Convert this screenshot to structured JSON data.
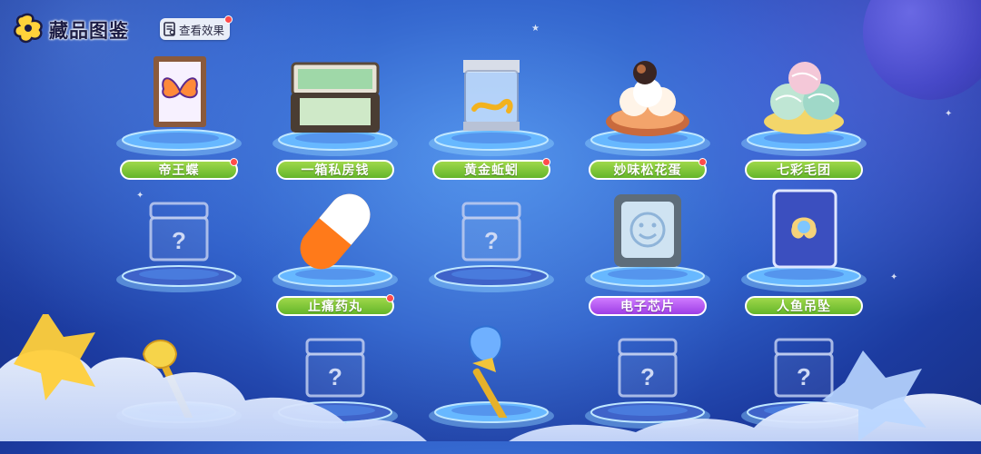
{
  "header": {
    "title": "藏品图鉴",
    "view_effect_label": "查看效果"
  },
  "colors": {
    "label_green": "#7cc43a",
    "label_purple": "#b45cf2",
    "badge_red": "#ff4b4b"
  },
  "rows": [
    [
      {
        "name": "帝王蝶",
        "collected": true,
        "new": true,
        "style": "green",
        "icon": "butterfly-frame-icon"
      },
      {
        "name": "一箱私房钱",
        "collected": true,
        "new": false,
        "style": "green",
        "icon": "money-briefcase-icon"
      },
      {
        "name": "黄金蚯蚓",
        "collected": true,
        "new": true,
        "style": "green",
        "icon": "golden-worm-box-icon"
      },
      {
        "name": "妙味松花蛋",
        "collected": true,
        "new": true,
        "style": "green",
        "icon": "preserved-egg-icon"
      },
      {
        "name": "七彩毛团",
        "collected": true,
        "new": false,
        "style": "green",
        "icon": "yarn-balls-icon"
      }
    ],
    [
      {
        "name": "",
        "collected": false,
        "style": "none",
        "icon": "locked-chest-icon"
      },
      {
        "name": "止痛药丸",
        "collected": true,
        "new": true,
        "style": "green",
        "icon": "pill-icon"
      },
      {
        "name": "",
        "collected": false,
        "style": "none",
        "icon": "locked-chest-icon"
      },
      {
        "name": "电子芯片",
        "collected": true,
        "new": false,
        "style": "purple",
        "icon": "chip-icon"
      },
      {
        "name": "人鱼吊坠",
        "collected": true,
        "new": false,
        "style": "green",
        "icon": "mermaid-pendant-icon"
      }
    ],
    [
      {
        "name": "",
        "collected": true,
        "style": "none",
        "icon": "golden-axe-icon"
      },
      {
        "name": "",
        "collected": false,
        "style": "none",
        "icon": "locked-chest-icon"
      },
      {
        "name": "",
        "collected": true,
        "style": "none",
        "icon": "crystal-scepter-icon"
      },
      {
        "name": "",
        "collected": false,
        "style": "none",
        "icon": "locked-chest-icon"
      },
      {
        "name": "",
        "collected": false,
        "style": "none",
        "icon": "locked-chest-icon"
      }
    ]
  ]
}
